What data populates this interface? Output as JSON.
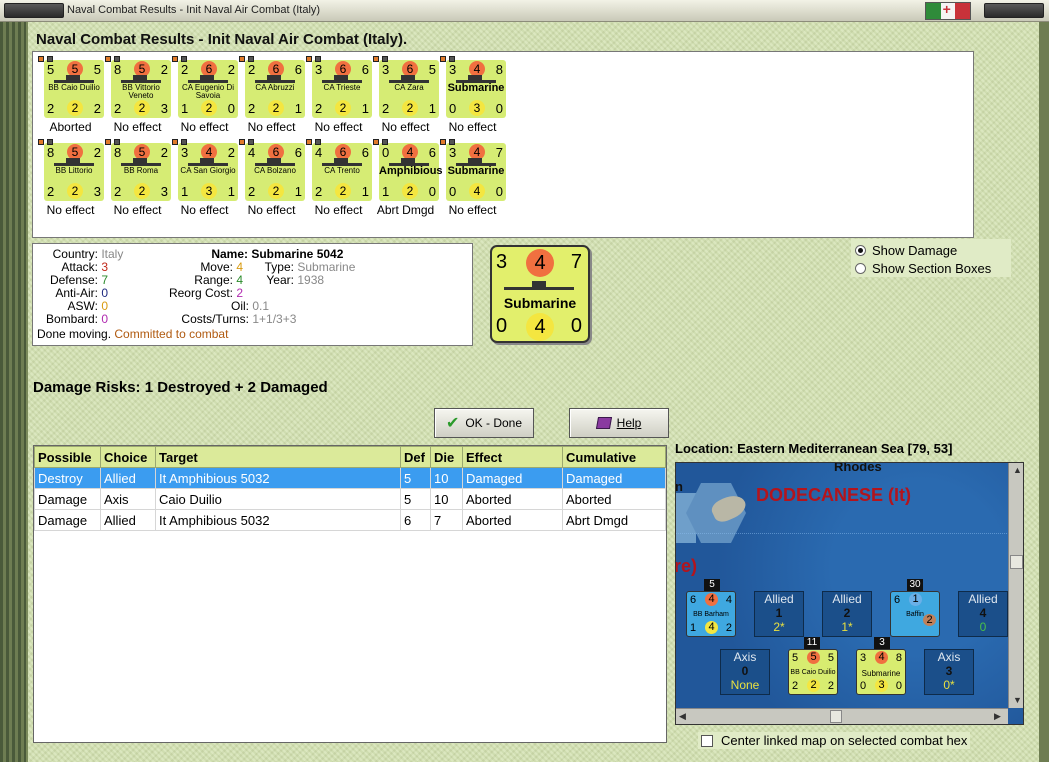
{
  "window": {
    "title": "Naval Combat Results - Init Naval Air Combat (Italy)",
    "heading": "Naval Combat Results - Init Naval Air Combat (Italy)."
  },
  "units": [
    {
      "tl": "5",
      "tm": "5",
      "tr": "5",
      "name": "BB Caio Duilio",
      "bl": "2",
      "bm": "2",
      "br": "2",
      "effect": "Aborted"
    },
    {
      "tl": "8",
      "tm": "5",
      "tr": "2",
      "name": "BB Vittorio Veneto",
      "bl": "2",
      "bm": "2",
      "br": "3",
      "effect": "No effect"
    },
    {
      "tl": "2",
      "tm": "6",
      "tr": "2",
      "name": "CA Eugenio Di Savoia",
      "bl": "1",
      "bm": "2",
      "br": "0",
      "effect": "No effect"
    },
    {
      "tl": "2",
      "tm": "6",
      "tr": "6",
      "name": "CA Abruzzi",
      "bl": "2",
      "bm": "2",
      "br": "1",
      "effect": "No effect"
    },
    {
      "tl": "3",
      "tm": "6",
      "tr": "6",
      "name": "CA Trieste",
      "bl": "2",
      "bm": "2",
      "br": "1",
      "effect": "No effect"
    },
    {
      "tl": "3",
      "tm": "6",
      "tr": "5",
      "name": "CA Zara",
      "bl": "2",
      "bm": "2",
      "br": "1",
      "effect": "No effect"
    },
    {
      "tl": "3",
      "tm": "4",
      "tr": "8",
      "name": "Submarine",
      "bl": "0",
      "bm": "3",
      "br": "0",
      "effect": "No effect",
      "big": true
    },
    {
      "tl": "8",
      "tm": "5",
      "tr": "2",
      "name": "BB Littorio",
      "bl": "2",
      "bm": "2",
      "br": "3",
      "effect": "No effect"
    },
    {
      "tl": "8",
      "tm": "5",
      "tr": "2",
      "name": "BB Roma",
      "bl": "2",
      "bm": "2",
      "br": "3",
      "effect": "No effect"
    },
    {
      "tl": "3",
      "tm": "4",
      "tr": "2",
      "name": "CA San Giorgio",
      "bl": "1",
      "bm": "3",
      "br": "1",
      "effect": "No effect"
    },
    {
      "tl": "4",
      "tm": "6",
      "tr": "6",
      "name": "CA Bolzano",
      "bl": "2",
      "bm": "2",
      "br": "1",
      "effect": "No effect"
    },
    {
      "tl": "4",
      "tm": "6",
      "tr": "6",
      "name": "CA Trento",
      "bl": "2",
      "bm": "2",
      "br": "1",
      "effect": "No effect"
    },
    {
      "tl": "0",
      "tm": "4",
      "tr": "6",
      "name": "Amphibious",
      "bl": "1",
      "bm": "2",
      "br": "0",
      "effect": "Abrt Dmgd",
      "big": true
    },
    {
      "tl": "3",
      "tm": "4",
      "tr": "7",
      "name": "Submarine",
      "bl": "0",
      "bm": "4",
      "br": "0",
      "effect": "No effect",
      "big": true
    }
  ],
  "info": {
    "country_label": "Country:",
    "country": "Italy",
    "attack_label": "Attack:",
    "attack": "3",
    "defense_label": "Defense:",
    "defense": "7",
    "antiair_label": "Anti-Air:",
    "antiair": "0",
    "asw_label": "ASW:",
    "asw": "0",
    "bombard_label": "Bombard:",
    "bombard": "0",
    "name_label": "Name:",
    "name": "Submarine 5042",
    "move_label": "Move:",
    "move": "4",
    "type_label": "Type:",
    "type": "Submarine",
    "range_label": "Range:",
    "range": "4",
    "year_label": "Year:",
    "year": "1938",
    "reorg_label": "Reorg Cost:",
    "reorg": "2",
    "oil_label": "Oil:",
    "oil": "0.1",
    "costs_label": "Costs/Turns:",
    "costs": "1+1/3+3",
    "status": "Done moving.",
    "status2": "Committed to combat"
  },
  "big_counter": {
    "tl": "3",
    "tm": "4",
    "tr": "7",
    "name": "Submarine",
    "bl": "0",
    "bm": "4",
    "br": "0"
  },
  "options": {
    "show_damage": "Show Damage",
    "show_sections": "Show Section Boxes"
  },
  "damage_risks": "Damage Risks:  1 Destroyed + 2 Damaged",
  "buttons": {
    "ok": "OK - Done",
    "help": "Help"
  },
  "table": {
    "headers": [
      "Possible",
      "Choice",
      "Target",
      "Def",
      "Die",
      "Effect",
      "Cumulative"
    ],
    "rows": [
      [
        "Destroy",
        "Allied",
        "It Amphibious 5032",
        "5",
        "10",
        "Damaged",
        "Damaged"
      ],
      [
        "Damage",
        "Axis",
        "Caio Duilio",
        "5",
        "10",
        "Aborted",
        "Aborted"
      ],
      [
        "Damage",
        "Allied",
        "It Amphibious 5032",
        "6",
        "7",
        "Aborted",
        "Abrt Dmgd"
      ]
    ]
  },
  "location": "Location:  Eastern Mediterranean Sea [79, 53]",
  "map": {
    "rhodes": "Rhodes",
    "dodecanese": "DODECANESE (It)",
    "re": "re)",
    "n": "n",
    "stack1": "5",
    "stack2": "30",
    "stack3": "11",
    "stack4": "3",
    "barham": {
      "tl": "6",
      "tm": "4",
      "tr": "4",
      "name": "BB Barham",
      "bl": "1",
      "bm": "4",
      "br": "2"
    },
    "baffin": {
      "tl": "6",
      "tm": "1",
      "tr": "",
      "name": "Baffin",
      "bl": "",
      "bm": "",
      "br": "2"
    },
    "duilio": {
      "tl": "5",
      "tm": "5",
      "tr": "5",
      "name": "BB Caio Duilio",
      "bl": "2",
      "bm": "2",
      "br": "2"
    },
    "sub": {
      "tl": "3",
      "tm": "4",
      "tr": "8",
      "name": "Submarine",
      "bl": "0",
      "bm": "3",
      "br": "0"
    },
    "tiles": [
      {
        "side": "Allied",
        "num": "1",
        "val": "2*"
      },
      {
        "side": "Allied",
        "num": "2",
        "val": "1*"
      },
      {
        "side": "Allied",
        "num": "4",
        "val": "0"
      },
      {
        "side": "Axis",
        "num": "0",
        "val": "None"
      },
      {
        "side": "Axis",
        "num": "3",
        "val": "0*"
      }
    ]
  },
  "center_map": "Center linked map on selected combat hex",
  "colors": {
    "counter": "#d6ec74",
    "attack_circle": "#f07040",
    "defense_circle": "#f4e640",
    "selected_row": "#3b9cf0"
  }
}
